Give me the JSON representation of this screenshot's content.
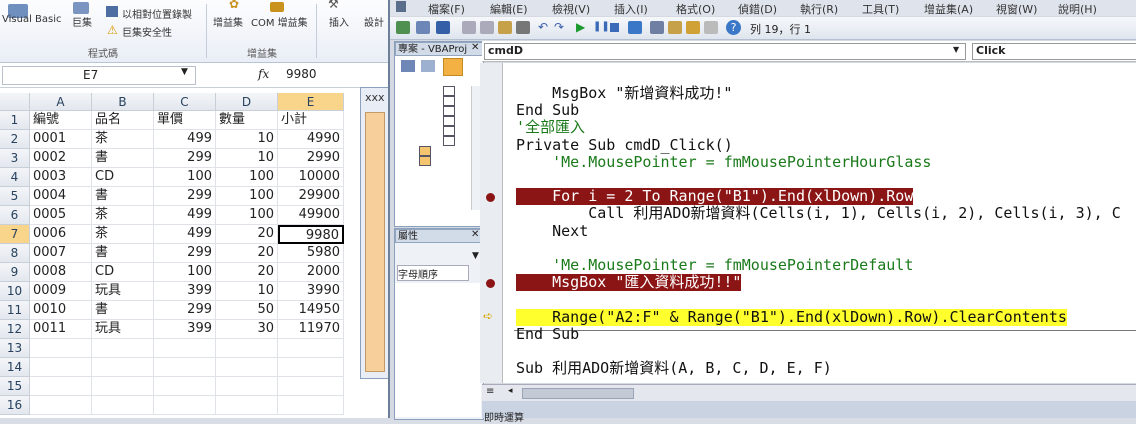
{
  "excel": {
    "ribbon": {
      "visual_basic": "Visual Basic",
      "macros": "巨集",
      "relative_ref": "以相對位置錄製",
      "macro_security": "巨集安全性",
      "addins": "增益集",
      "com_addins": "COM 增益集",
      "insert": "插入",
      "design": "設計",
      "group_code": "程式碼",
      "group_addins": "增益集"
    },
    "name_box": "E7",
    "fx": "fx",
    "formula_value": "9980",
    "columns": [
      "A",
      "B",
      "C",
      "D",
      "E"
    ],
    "rows": [
      {
        "n": "1",
        "a": "編號",
        "b": "品名",
        "c": "單價",
        "d": "數量",
        "e": "小計"
      },
      {
        "n": "2",
        "a": "0001",
        "b": "茶",
        "c": "499",
        "d": "10",
        "e": "4990"
      },
      {
        "n": "3",
        "a": "0002",
        "b": "書",
        "c": "299",
        "d": "10",
        "e": "2990"
      },
      {
        "n": "4",
        "a": "0003",
        "b": "CD",
        "c": "100",
        "d": "100",
        "e": "10000"
      },
      {
        "n": "5",
        "a": "0004",
        "b": "書",
        "c": "299",
        "d": "100",
        "e": "29900"
      },
      {
        "n": "6",
        "a": "0005",
        "b": "茶",
        "c": "499",
        "d": "100",
        "e": "49900"
      },
      {
        "n": "7",
        "a": "0006",
        "b": "茶",
        "c": "499",
        "d": "20",
        "e": "9980"
      },
      {
        "n": "8",
        "a": "0007",
        "b": "書",
        "c": "299",
        "d": "20",
        "e": "5980"
      },
      {
        "n": "9",
        "a": "0008",
        "b": "CD",
        "c": "100",
        "d": "20",
        "e": "2000"
      },
      {
        "n": "10",
        "a": "0009",
        "b": "玩具",
        "c": "399",
        "d": "10",
        "e": "3990"
      },
      {
        "n": "11",
        "a": "0010",
        "b": "書",
        "c": "299",
        "d": "50",
        "e": "14950"
      },
      {
        "n": "12",
        "a": "0011",
        "b": "玩具",
        "c": "399",
        "d": "30",
        "e": "11970"
      },
      {
        "n": "13",
        "a": "",
        "b": "",
        "c": "",
        "d": "",
        "e": ""
      },
      {
        "n": "14",
        "a": "",
        "b": "",
        "c": "",
        "d": "",
        "e": ""
      },
      {
        "n": "15",
        "a": "",
        "b": "",
        "c": "",
        "d": "",
        "e": ""
      },
      {
        "n": "16",
        "a": "",
        "b": "",
        "c": "",
        "d": "",
        "e": ""
      }
    ],
    "dialog_title": "xxx"
  },
  "vbe": {
    "menu": [
      "檔案(F)",
      "編輯(E)",
      "檢視(V)",
      "插入(I)",
      "格式(O)",
      "偵錯(D)",
      "執行(R)",
      "工具(T)",
      "增益集(A)",
      "視窗(W)",
      "說明(H)"
    ],
    "position": "列 19，行 1",
    "project_title": "專案 - VBAProj",
    "props_title": "屬性",
    "props_tab": "字母順序",
    "object_combo": "cmdD",
    "proc_combo": "Click",
    "status": "即時運算"
  },
  "code_lines": [
    "    MsgBox \"新增資料成功!\"",
    "End Sub",
    "'全部匯入",
    "Private Sub cmdD_Click()",
    "    'Me.MousePointer = fmMousePointerHourGlass",
    "",
    "    For i = 2 To Range(\"B1\").End(xlDown).Row",
    "        Call 利用ADO新增資料(Cells(i, 1), Cells(i, 2), Cells(i, 3), C",
    "    Next",
    "",
    "    'Me.MousePointer = fmMousePointerDefault",
    "    MsgBox \"匯入資料成功!!\"",
    "",
    "    Range(\"A2:F\" & Range(\"B1\").End(xlDown).Row).ClearContents",
    "End Sub",
    "",
    "Sub 利用ADO新增資料(A, B, C, D, E, F)"
  ]
}
